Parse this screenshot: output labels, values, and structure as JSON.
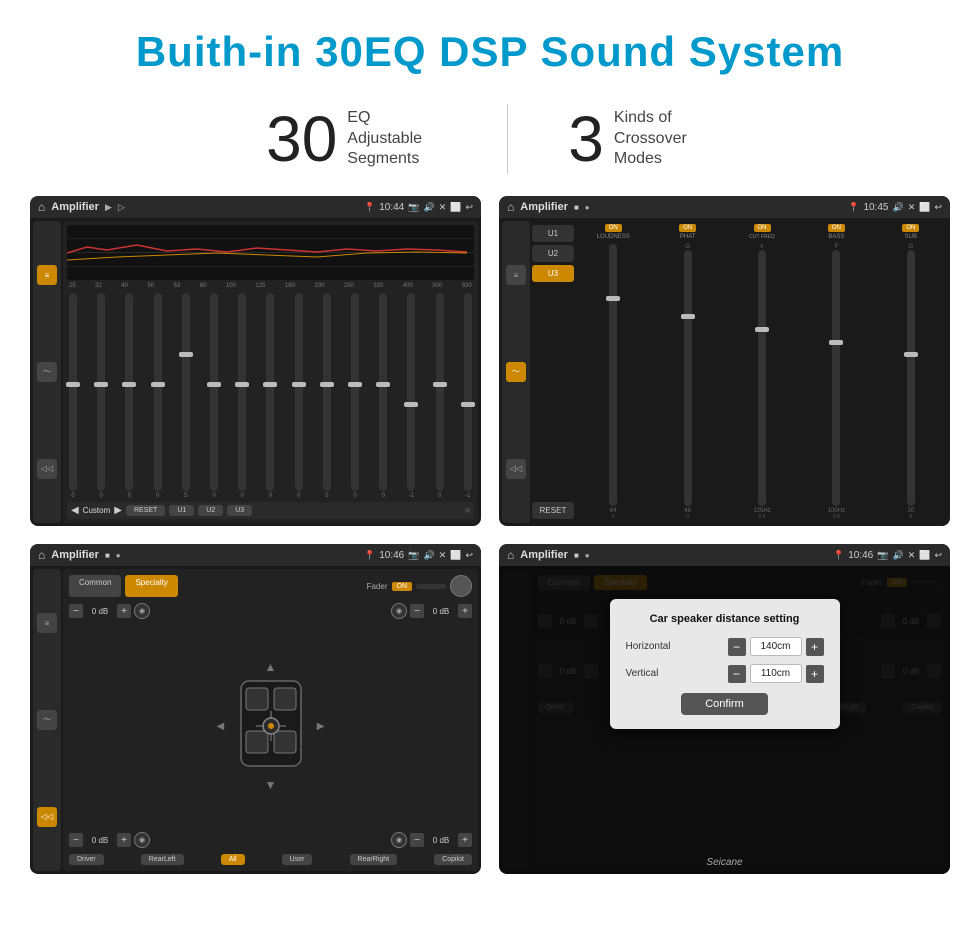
{
  "page": {
    "title": "Buith-in 30EQ DSP Sound System",
    "stat1_number": "30",
    "stat1_label": "EQ Adjustable\nSegments",
    "stat2_number": "3",
    "stat2_label": "Kinds of\nCrossover Modes"
  },
  "screen1": {
    "app_name": "Amplifier",
    "time": "10:44",
    "freq_labels": [
      "25",
      "32",
      "40",
      "50",
      "63",
      "80",
      "100",
      "125",
      "160",
      "200",
      "250",
      "320",
      "400",
      "500",
      "630"
    ],
    "slider_vals": [
      "0",
      "0",
      "0",
      "0",
      "5",
      "0",
      "0",
      "0",
      "0",
      "0",
      "0",
      "0",
      "-1",
      "0",
      "-1"
    ],
    "bottom_label": "Custom",
    "btns": [
      "RESET",
      "U1",
      "U2",
      "U3"
    ]
  },
  "screen2": {
    "app_name": "Amplifier",
    "time": "10:45",
    "presets": [
      "U1",
      "U2",
      "U3"
    ],
    "active_preset": "U3",
    "channels": [
      {
        "name": "LOUDNESS",
        "toggle": "ON"
      },
      {
        "name": "PHAT",
        "toggle": "ON"
      },
      {
        "name": "CUT FREQ",
        "toggle": "ON"
      },
      {
        "name": "BASS",
        "toggle": "ON"
      },
      {
        "name": "SUB",
        "toggle": "ON"
      }
    ],
    "reset_btn": "RESET"
  },
  "screen3": {
    "app_name": "Amplifier",
    "time": "10:46",
    "tabs": [
      "Common",
      "Specialty"
    ],
    "active_tab": "Specialty",
    "fader_label": "Fader",
    "fader_on": "ON",
    "db_values": [
      "0 dB",
      "0 dB",
      "0 dB",
      "0 dB"
    ],
    "zone_btns": [
      "Driver",
      "RearLeft",
      "All",
      "User",
      "RearRight",
      "Copilot"
    ],
    "active_zone": "All"
  },
  "screen4": {
    "app_name": "Amplifier",
    "time": "10:46",
    "dialog": {
      "title": "Car speaker distance setting",
      "horizontal_label": "Horizontal",
      "horizontal_value": "140cm",
      "vertical_label": "Vertical",
      "vertical_value": "110cm",
      "confirm_btn": "Confirm"
    }
  },
  "watermark": "Seicane"
}
